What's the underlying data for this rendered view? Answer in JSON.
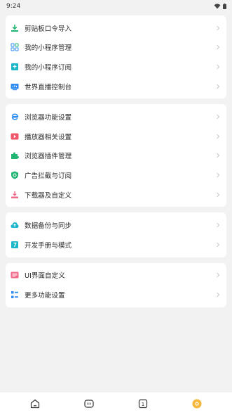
{
  "status_bar": {
    "time": "9:24"
  },
  "groups": [
    {
      "items": [
        {
          "label": "剪贴板口令导入",
          "icon": "clipboard-import-icon"
        },
        {
          "label": "我的小程序管理",
          "icon": "apps-grid-icon"
        },
        {
          "label": "我的小程序订阅",
          "icon": "subscribe-icon"
        },
        {
          "label": "世界直播控制台",
          "icon": "live-console-icon"
        }
      ]
    },
    {
      "items": [
        {
          "label": "浏览器功能设置",
          "icon": "browser-e-icon"
        },
        {
          "label": "播放器相关设置",
          "icon": "play-icon"
        },
        {
          "label": "浏览器插件管理",
          "icon": "puzzle-icon"
        },
        {
          "label": "广告拦截与订阅",
          "icon": "shield-icon"
        },
        {
          "label": "下载器及自定义",
          "icon": "download-icon"
        }
      ]
    },
    {
      "items": [
        {
          "label": "数据备份与同步",
          "icon": "cloud-sync-icon"
        },
        {
          "label": "开发手册与模式",
          "icon": "manual-icon"
        }
      ]
    },
    {
      "items": [
        {
          "label": "UI界面自定义",
          "icon": "ui-theme-icon"
        },
        {
          "label": "更多功能设置",
          "icon": "more-settings-icon"
        }
      ]
    }
  ],
  "bottom_nav": {
    "items": [
      {
        "icon": "home-icon",
        "value": ""
      },
      {
        "icon": "media-icon",
        "value": ""
      },
      {
        "icon": "tabs-icon",
        "value": "1"
      },
      {
        "icon": "settings-active-icon",
        "value": ""
      }
    ]
  },
  "colors": {
    "green": "#22b573",
    "blue": "#2d8cf0",
    "red": "#f0566b",
    "teal": "#1cb6c9",
    "pink": "#f06a8a",
    "orange": "#f5b83d"
  }
}
